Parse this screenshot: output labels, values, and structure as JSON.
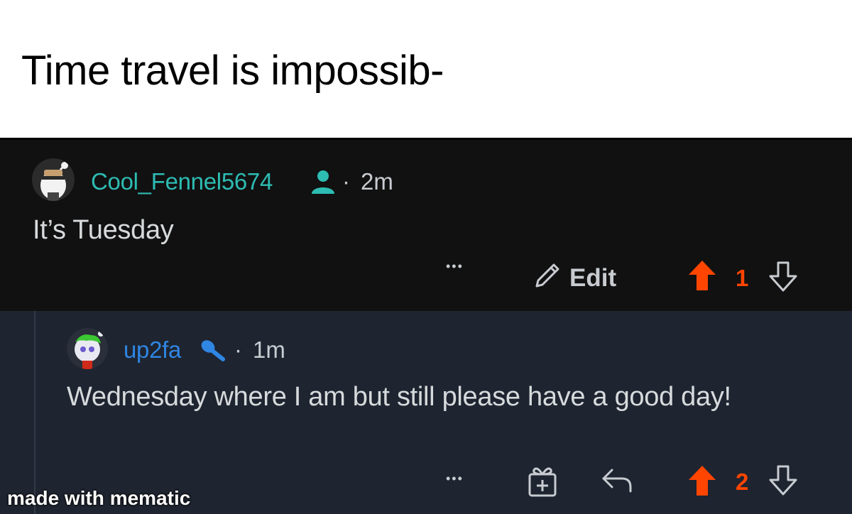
{
  "caption": {
    "text": "Time travel is impossib-"
  },
  "comments": [
    {
      "username": "Cool_Fennel5674",
      "username_color": "#2dbcb2",
      "badge_icon": "person-icon",
      "separator": "·",
      "age": "2m",
      "body": "It’s Tuesday",
      "actions": {
        "more": "•••",
        "edit_label": "Edit",
        "votes": "1",
        "upvoted": true
      }
    },
    {
      "username": "up2fa",
      "username_color": "#2f86e3",
      "badge_icon": "microphone-icon",
      "separator": "·",
      "age": "1m",
      "body": "Wednesday where I am but still please have a good day!",
      "actions": {
        "more": "•••",
        "votes": "2",
        "upvoted": true
      }
    }
  ],
  "watermark": "made with mematic",
  "colors": {
    "upvote": "#ff4500",
    "teal": "#2dbcb2",
    "blue": "#2f86e3"
  }
}
